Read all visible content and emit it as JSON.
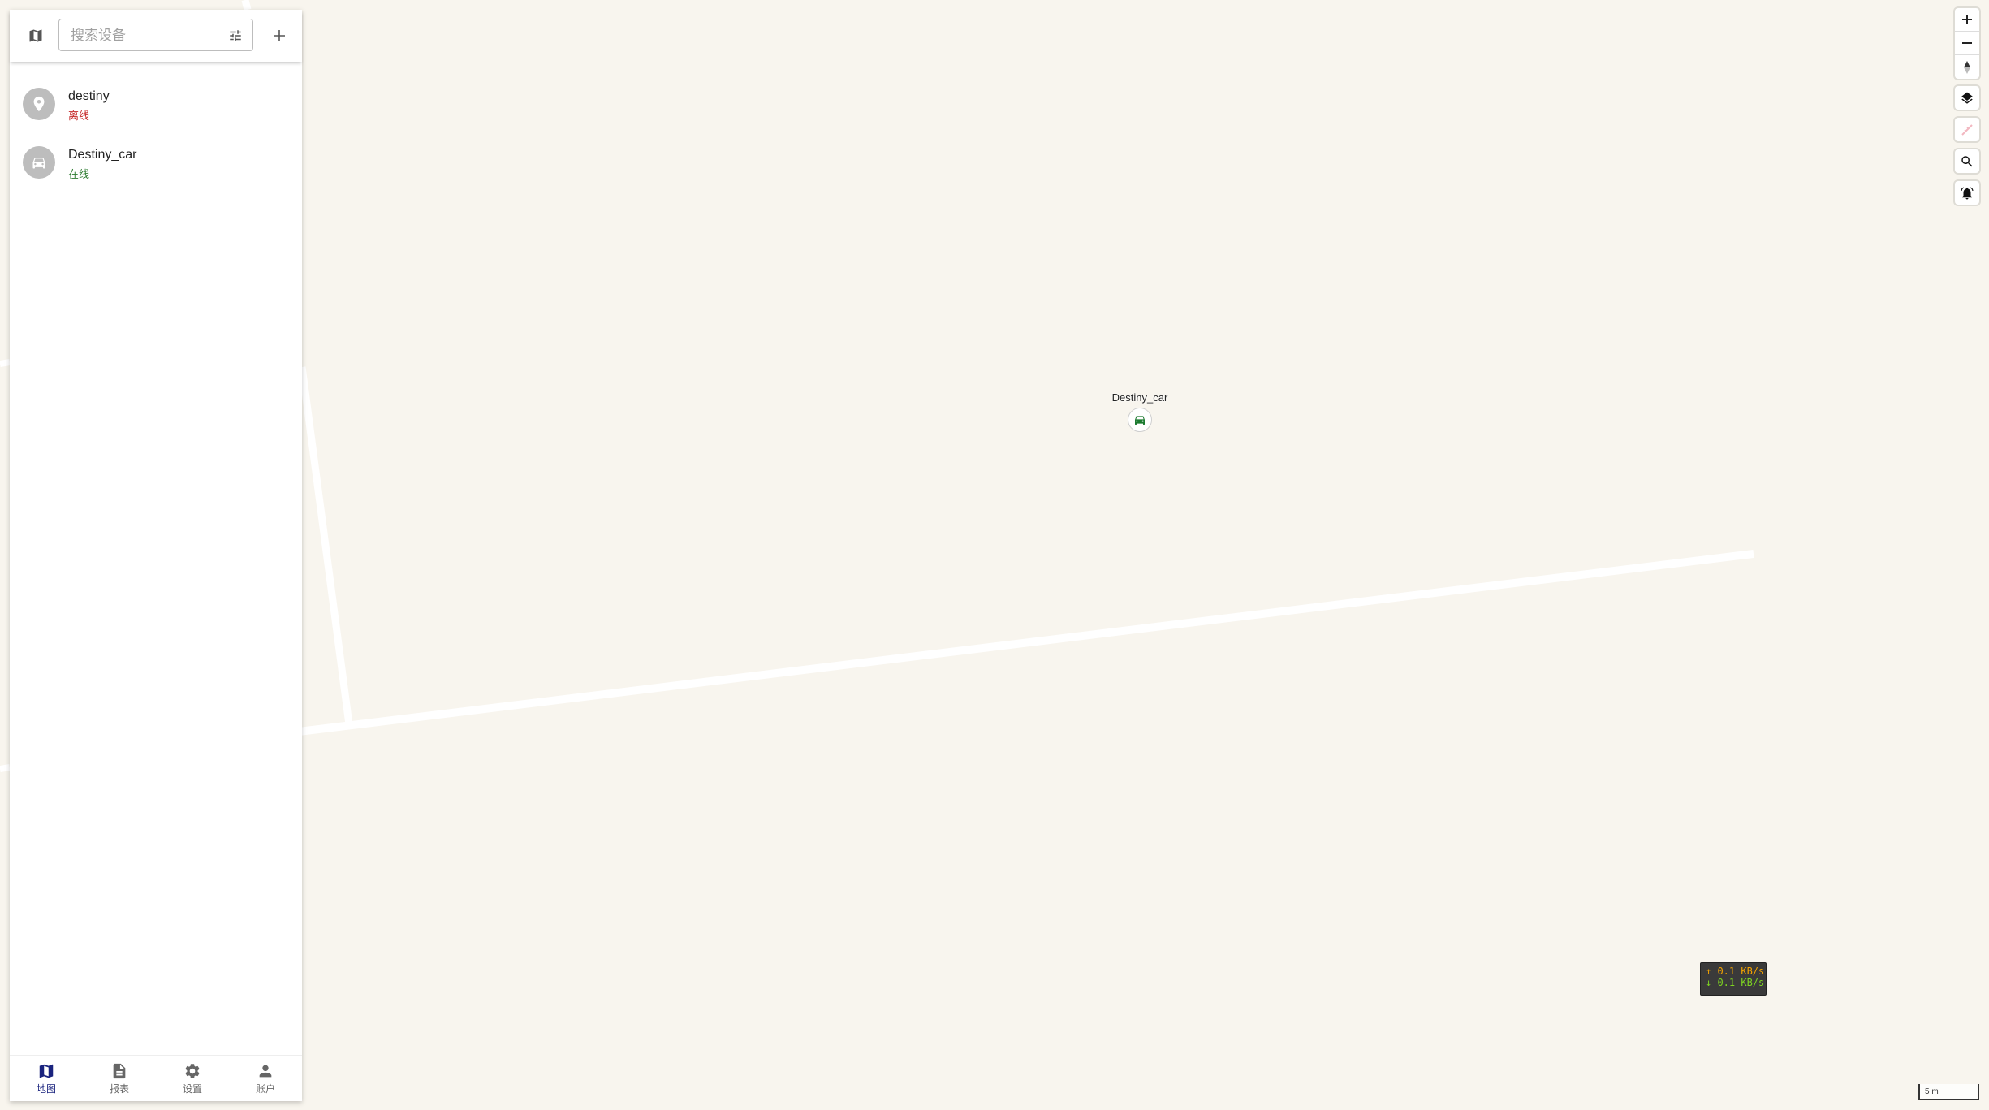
{
  "search": {
    "placeholder": "搜索设备"
  },
  "devices": [
    {
      "name": "destiny",
      "status": "离线",
      "status_color": "#c62828",
      "icon": "map-pin-icon"
    },
    {
      "name": "Destiny_car",
      "status": "在线",
      "status_color": "#2e7d32",
      "icon": "car-icon"
    }
  ],
  "nav": {
    "items": [
      {
        "label": "地图",
        "icon": "map-icon",
        "active": true
      },
      {
        "label": "报表",
        "icon": "document-icon",
        "active": false
      },
      {
        "label": "设置",
        "icon": "gear-icon",
        "active": false
      },
      {
        "label": "账户",
        "icon": "person-icon",
        "active": false
      }
    ]
  },
  "map": {
    "marker": {
      "label": "Destiny_car",
      "color": "#1b7a2f"
    },
    "scale_label": "5 m"
  },
  "netspeed": {
    "up": "↑ 0.1 KB/s",
    "down": "↓ 0.1 KB/s"
  },
  "colors": {
    "accent": "#1a237e",
    "map_bg": "#f8f5ee"
  }
}
